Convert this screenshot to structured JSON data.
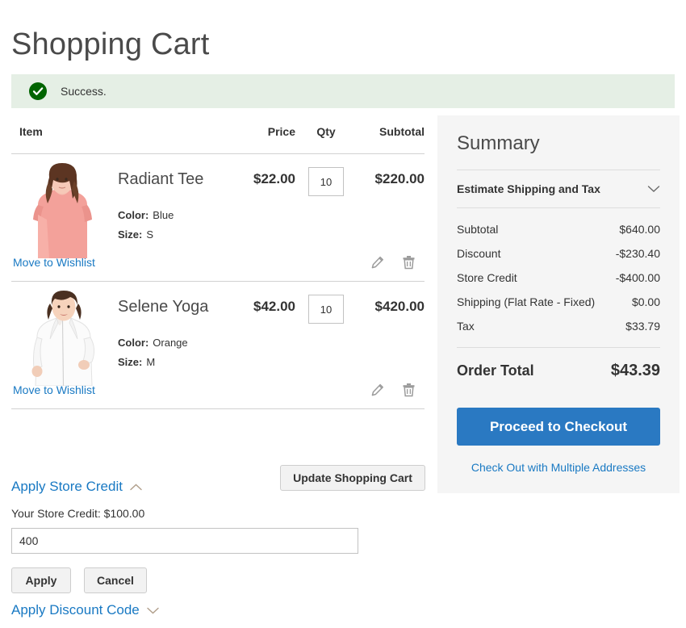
{
  "page": {
    "title": "Shopping Cart"
  },
  "message": {
    "icon": "check-circle-icon",
    "text": "Success.",
    "background_color": "#e5efe5",
    "icon_color": "#006400"
  },
  "cart": {
    "columns": {
      "item": "Item",
      "price": "Price",
      "qty": "Qty",
      "subtotal": "Subtotal"
    },
    "items": [
      {
        "name": "Radiant Tee",
        "price": "$22.00",
        "qty": "10",
        "subtotal": "$220.00",
        "options": [
          {
            "label": "Color:",
            "value": "Blue"
          },
          {
            "label": "Size:",
            "value": "S"
          }
        ],
        "wishlist_label": "Move to Wishlist",
        "image_alt": "woman-in-coral-tee",
        "garment_color": "#f29c96"
      },
      {
        "name": "Selene Yoga",
        "price": "$42.00",
        "qty": "10",
        "subtotal": "$420.00",
        "options": [
          {
            "label": "Color:",
            "value": "Orange"
          },
          {
            "label": "Size:",
            "value": "M"
          }
        ],
        "wishlist_label": "Move to Wishlist",
        "image_alt": "woman-in-white-hoodie",
        "garment_color": "#f4f4f4"
      }
    ],
    "update_button": "Update Shopping Cart"
  },
  "store_credit": {
    "toggle_label": "Apply Store Credit",
    "toggle_state": "expanded",
    "balance_note": "Your Store Credit: $100.00",
    "input_value": "400",
    "input_placeholder": "",
    "apply_label": "Apply",
    "cancel_label": "Cancel"
  },
  "discount": {
    "toggle_label": "Apply Discount Code",
    "toggle_state": "collapsed"
  },
  "summary": {
    "title": "Summary",
    "estimate_label": "Estimate Shipping and Tax",
    "rows": [
      {
        "label": "Subtotal",
        "value": "$640.00"
      },
      {
        "label": "Discount",
        "value": "-$230.40"
      },
      {
        "label": "Store Credit",
        "value": "-$400.00"
      },
      {
        "label": "Shipping (Flat Rate - Fixed)",
        "value": "$0.00"
      },
      {
        "label": "Tax",
        "value": "$33.79"
      }
    ],
    "order_total_label": "Order Total",
    "order_total_value": "$43.39",
    "checkout_label": "Proceed to Checkout",
    "multi_address_label": "Check Out with Multiple Addresses",
    "accent_color": "#2a79c2",
    "panel_color": "#f5f5f5"
  }
}
